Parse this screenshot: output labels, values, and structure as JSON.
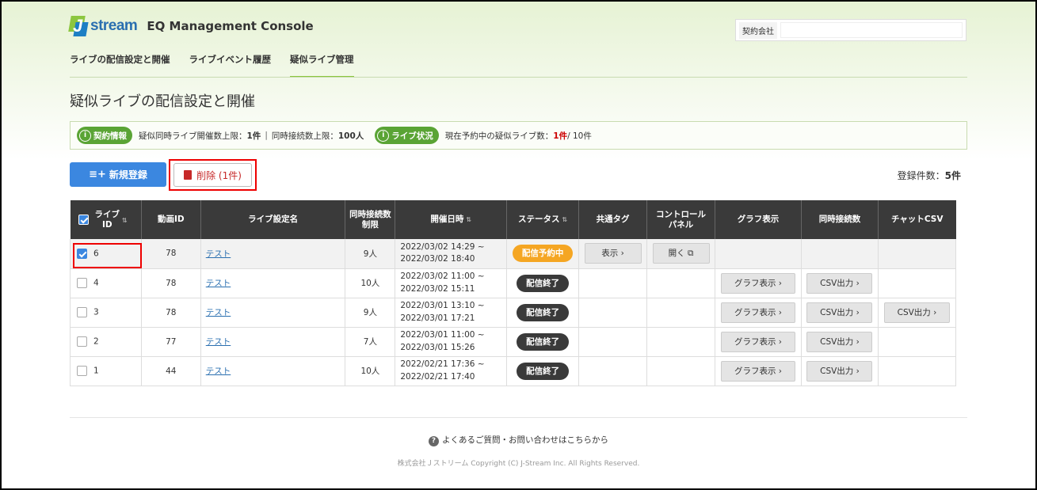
{
  "header": {
    "logo_text": "stream",
    "logo_letter": "J",
    "app_title": "EQ Management Console",
    "company_label": "契約会社",
    "company_value": ""
  },
  "nav": {
    "items": [
      {
        "label": "ライブの配信設定と開催"
      },
      {
        "label": "ライブイベント履歴"
      },
      {
        "label": "疑似ライブ管理"
      }
    ],
    "active": "疑似ライブ管理"
  },
  "page_title": "疑似ライブの配信設定と開催",
  "info": {
    "contract_badge": "契約情報",
    "concurrent_live_label": "疑似同時ライブ開催数上限：",
    "concurrent_live_value": "1件",
    "concurrent_conn_label": "同時接続数上限：",
    "concurrent_conn_value": "100人",
    "status_badge": "ライブ状況",
    "scheduled_label": "現在予約中の疑似ライブ数：",
    "scheduled_value": "1件",
    "scheduled_total": " / 10件"
  },
  "toolbar": {
    "new_label": "新規登録",
    "delete_label": "削除 (1件)",
    "count_label": "登録件数：",
    "count_value": "5件"
  },
  "table": {
    "headers": {
      "live_id": "ライブ\nID",
      "video_id": "動画ID",
      "name": "ライブ設定名",
      "limit": "同時接続数\n制限",
      "datetime": "開催日時",
      "status": "ステータス",
      "tag": "共通タグ",
      "panel": "コントロール\nパネル",
      "graph": "グラフ表示",
      "concurrent": "同時接続数",
      "chat": "チャットCSV"
    },
    "rows": [
      {
        "live_id": "6",
        "video_id": "78",
        "name": "テスト",
        "limit": "9人",
        "start": "2022/03/02 14:29 ~",
        "end": "2022/03/02 18:40",
        "status": "配信予約中",
        "status_type": "scheduled",
        "tag_btn": "表示 ›",
        "panel_btn": "開く ⧉",
        "graph_btn": "",
        "conc_btn": "",
        "chat_btn": "",
        "checked": true
      },
      {
        "live_id": "4",
        "video_id": "78",
        "name": "テスト",
        "limit": "10人",
        "start": "2022/03/02 11:00 ~",
        "end": "2022/03/02 15:11",
        "status": "配信終了",
        "status_type": "ended",
        "tag_btn": "",
        "panel_btn": "",
        "graph_btn": "グラフ表示 ›",
        "conc_btn": "CSV出力 ›",
        "chat_btn": "",
        "checked": false
      },
      {
        "live_id": "3",
        "video_id": "78",
        "name": "テスト",
        "limit": "9人",
        "start": "2022/03/01 13:10 ~",
        "end": "2022/03/01 17:21",
        "status": "配信終了",
        "status_type": "ended",
        "tag_btn": "",
        "panel_btn": "",
        "graph_btn": "グラフ表示 ›",
        "conc_btn": "CSV出力 ›",
        "chat_btn": "CSV出力 ›",
        "checked": false
      },
      {
        "live_id": "2",
        "video_id": "77",
        "name": "テスト",
        "limit": "7人",
        "start": "2022/03/01 11:00 ~",
        "end": "2022/03/01 15:26",
        "status": "配信終了",
        "status_type": "ended",
        "tag_btn": "",
        "panel_btn": "",
        "graph_btn": "グラフ表示 ›",
        "conc_btn": "CSV出力 ›",
        "chat_btn": "",
        "checked": false
      },
      {
        "live_id": "1",
        "video_id": "44",
        "name": "テスト",
        "limit": "10人",
        "start": "2022/02/21 17:36 ~",
        "end": "2022/02/21 17:40",
        "status": "配信終了",
        "status_type": "ended",
        "tag_btn": "",
        "panel_btn": "",
        "graph_btn": "グラフ表示 ›",
        "conc_btn": "CSV出力 ›",
        "chat_btn": "",
        "checked": false
      }
    ]
  },
  "footer": {
    "faq": "よくあるご質問・お問い合わせはこちらから",
    "copyright": "株式会社Ｊストリーム Copyright (C) J-Stream Inc. All Rights Reserved."
  },
  "colors": {
    "accent_green": "#5aa435",
    "primary_blue": "#3b87e0",
    "danger_red": "#c62828",
    "scheduled_orange": "#f5a623",
    "ended_dark": "#3a3a3a"
  }
}
